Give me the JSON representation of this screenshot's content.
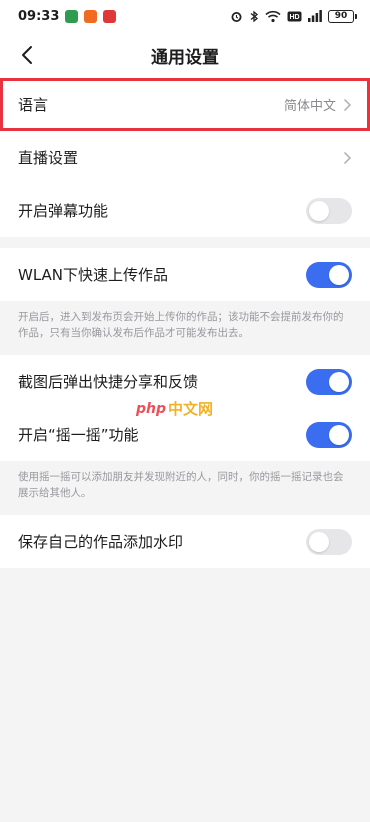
{
  "status_bar": {
    "time": "09:33",
    "battery": "90",
    "icons": [
      "app-icon-1",
      "app-icon-2",
      "app-icon-3",
      "alarm-icon",
      "bluetooth-icon",
      "wifi-icon",
      "hd-icon",
      "signal-icon"
    ]
  },
  "nav": {
    "title": "通用设置",
    "back_icon": "back-arrow-icon"
  },
  "section1": {
    "language": {
      "label": "语言",
      "value": "简体中文"
    },
    "live": {
      "label": "直播设置"
    },
    "danmaku": {
      "label": "开启弹幕功能",
      "toggle": "off"
    }
  },
  "section2": {
    "wlan": {
      "label": "WLAN下快速上传作品",
      "toggle": "on"
    },
    "note": "开启后，进入到发布页会开始上传你的作品；该功能不会提前发布你的作品，只有当你确认发布后作品才可能发布出去。"
  },
  "section3": {
    "screenshot": {
      "label": "截图后弹出快捷分享和反馈",
      "toggle": "on"
    },
    "shake": {
      "label": "开启“摇一摇”功能",
      "toggle": "on"
    },
    "note": "使用摇一摇可以添加朋友并发现附近的人，同时，你的摇一摇记录也会展示给其他人。"
  },
  "section4": {
    "watermark": {
      "label": "保存自己的作品添加水印",
      "toggle": "off"
    }
  },
  "overlay_watermark": {
    "php": "php",
    "cn": "中文网"
  },
  "colors": {
    "accent": "#3a6df0",
    "highlight": "#e8323f",
    "toggle_off": "#e6e6e8"
  }
}
